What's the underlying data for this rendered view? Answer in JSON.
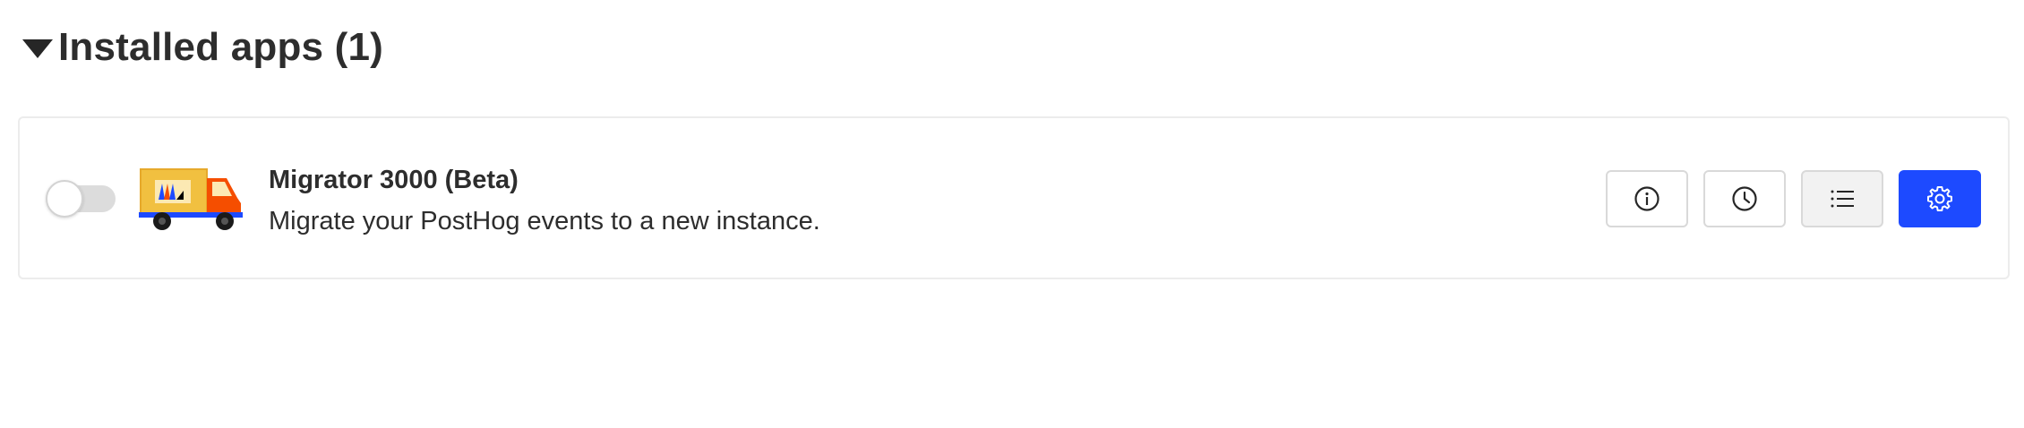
{
  "section": {
    "title": "Installed apps (1)",
    "caret_icon": "caret-down-icon"
  },
  "apps": [
    {
      "name": "Migrator 3000 (Beta)",
      "description": "Migrate your PostHog events to a new instance.",
      "enabled": false,
      "logo_icon": "truck-logo-icon",
      "actions": [
        {
          "name": "info-button",
          "icon": "info-icon"
        },
        {
          "name": "history-button",
          "icon": "clock-icon"
        },
        {
          "name": "logs-button",
          "icon": "list-icon"
        },
        {
          "name": "settings-button",
          "icon": "gear-icon"
        }
      ]
    }
  ],
  "colors": {
    "primary": "#1d4aff",
    "text": "#2d2d2d",
    "border": "#ececec",
    "toggle_off": "#dcdcdc"
  }
}
